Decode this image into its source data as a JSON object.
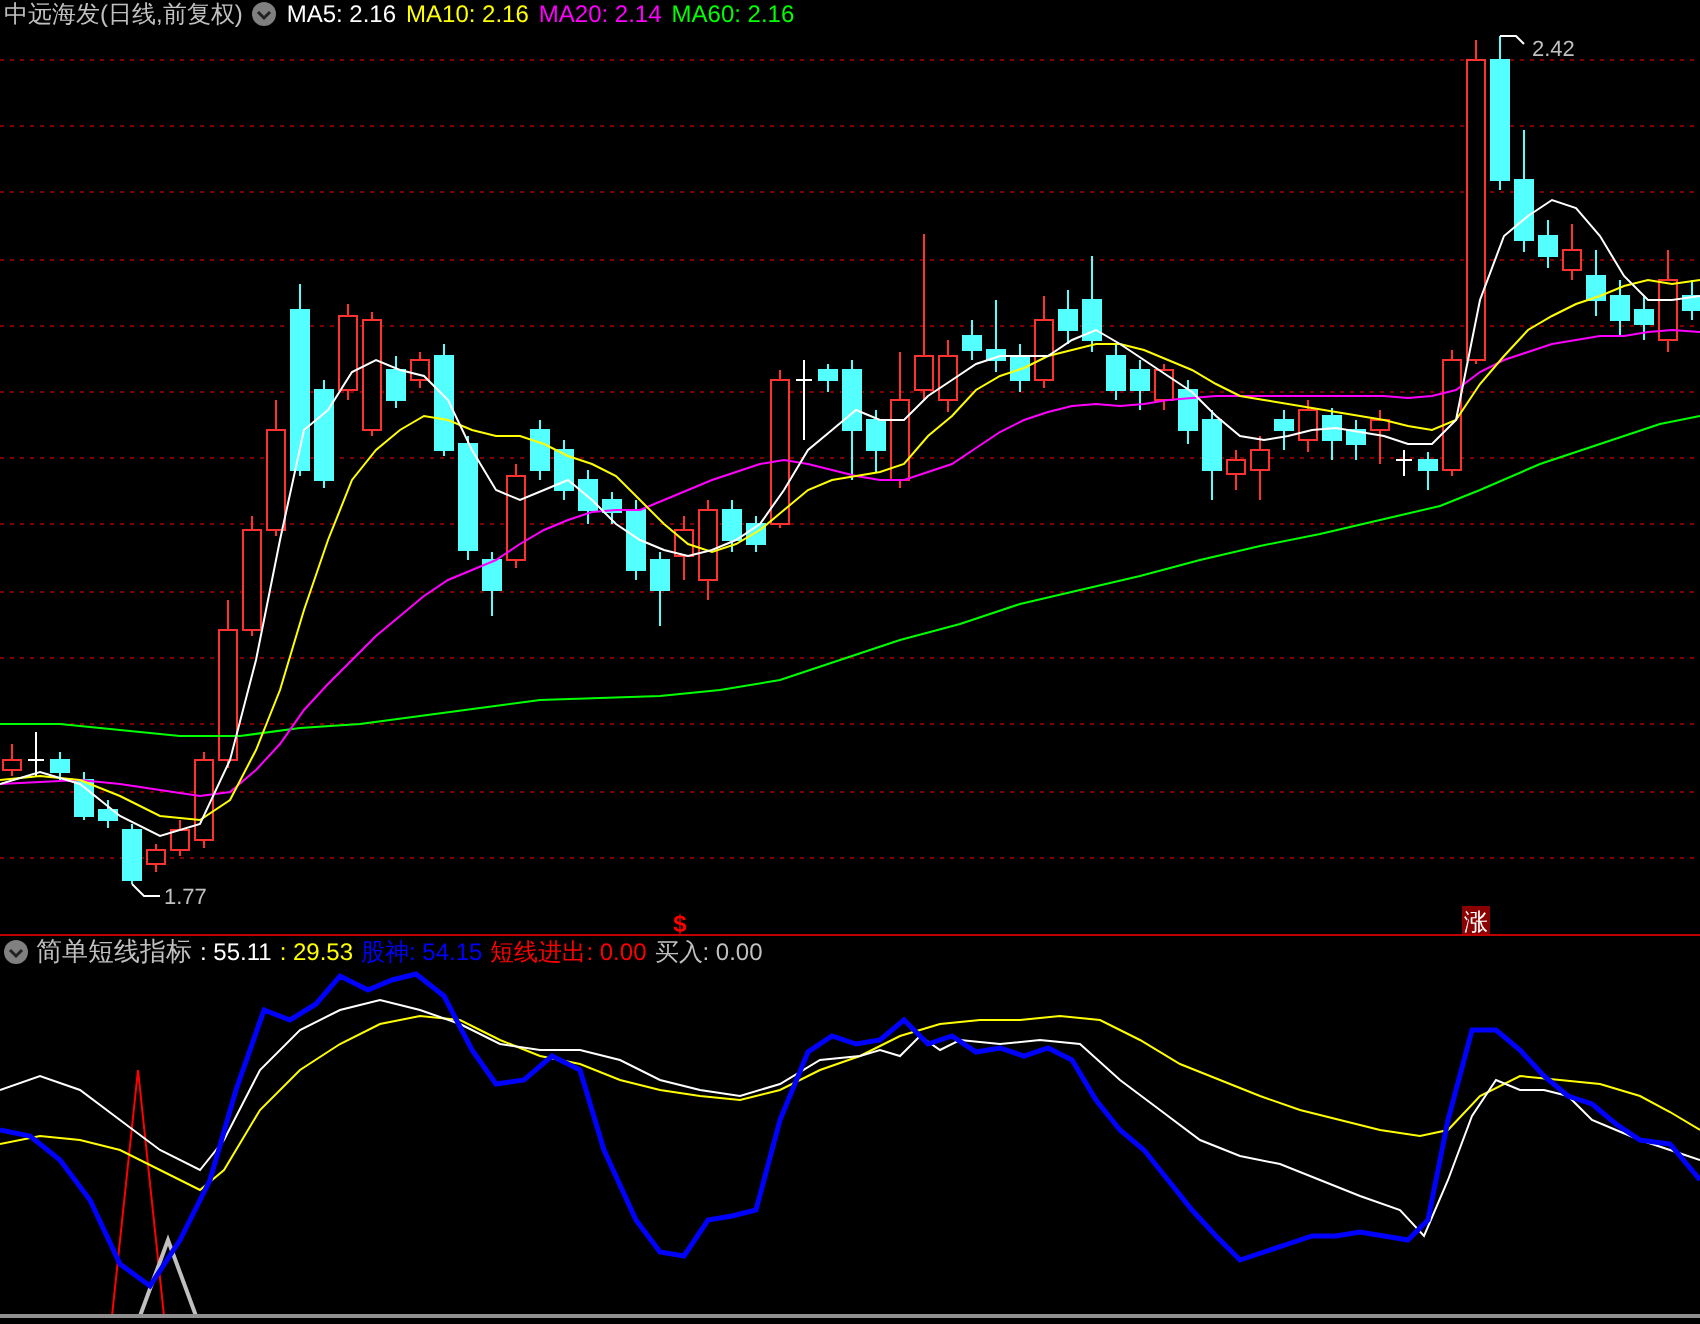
{
  "chart": {
    "title": "中远海发(日线,前复权)",
    "ma": [
      {
        "label": "MA5: 2.16",
        "color": "#ffffff"
      },
      {
        "label": "MA10: 2.16",
        "color": "#ffff00"
      },
      {
        "label": "MA20: 2.14",
        "color": "#ff00ff"
      },
      {
        "label": "MA60: 2.16",
        "color": "#00ff00"
      }
    ],
    "high_label": "2.42",
    "low_label": "1.77",
    "signals": [
      {
        "kind": "dollar",
        "text": "$"
      },
      {
        "kind": "rise",
        "text": "涨"
      }
    ]
  },
  "indicator": {
    "title": "简单短线指标",
    "values": [
      {
        "label": ": 55.11",
        "color": "#ffffff"
      },
      {
        "label": ": 29.53",
        "color": "#ffff00"
      },
      {
        "label": "股神: 54.15",
        "color": "#0000ff"
      },
      {
        "label": "短线进出: 0.00",
        "color": "#ff0000"
      },
      {
        "label": "买入: 0.00",
        "color": "#c0c0c0"
      }
    ]
  }
}
